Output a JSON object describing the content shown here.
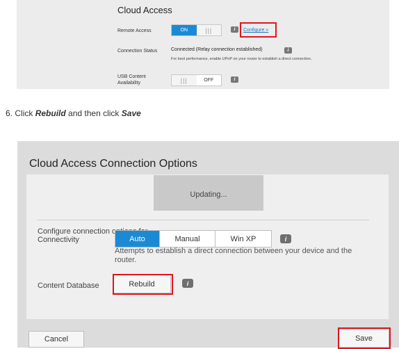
{
  "top_panel": {
    "title": "Cloud Access",
    "remote_access": {
      "label": "Remote Access",
      "toggle_on": "ON",
      "configure_link": "Configure »"
    },
    "connection_status": {
      "label": "Connection Status",
      "value": "Connected (Relay connection established)",
      "note": "For best performance, enable UPnP on your router to establish a direct connection."
    },
    "usb_content": {
      "label_line1": "USB Content",
      "label_line2": "Availability",
      "toggle_off": "OFF"
    },
    "grip_glyph": "|||",
    "info_glyph": "i"
  },
  "step": {
    "number": "6.",
    "text_before": "Click",
    "action1": "Rebuild",
    "text_middle": "and then click",
    "action2": "Save"
  },
  "dialog": {
    "title": "Cloud Access Connection Options",
    "configure_label": "Configure connection options for",
    "updating_text": "Updating...",
    "connectivity": {
      "label": "Connectivity",
      "options": [
        "Auto",
        "Manual",
        "Win XP"
      ],
      "selected": "Auto",
      "hint": "Attempts to establish a direct connection between your device and the router."
    },
    "content_database": {
      "label": "Content Database",
      "rebuild_button": "Rebuild"
    },
    "cancel_button": "Cancel",
    "save_button": "Save"
  },
  "colors": {
    "accent": "#1a8ad4",
    "highlight": "#e0141e",
    "link": "#1a73c9"
  }
}
